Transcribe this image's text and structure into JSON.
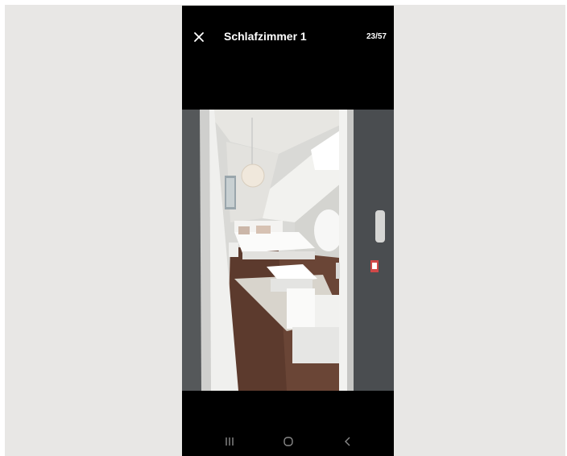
{
  "viewer": {
    "title": "Schlafzimmer 1",
    "counter": "23/57",
    "close_icon": "close-icon"
  },
  "photo": {
    "subject": "bedroom-photo"
  },
  "navbar": {
    "recent_icon": "recent-apps-icon",
    "home_icon": "home-icon",
    "back_icon": "back-icon"
  },
  "colors": {
    "background": "#e8e7e5",
    "viewer_bg": "#000000",
    "text": "#ffffff",
    "nav_icons": "#8a8a8a"
  }
}
